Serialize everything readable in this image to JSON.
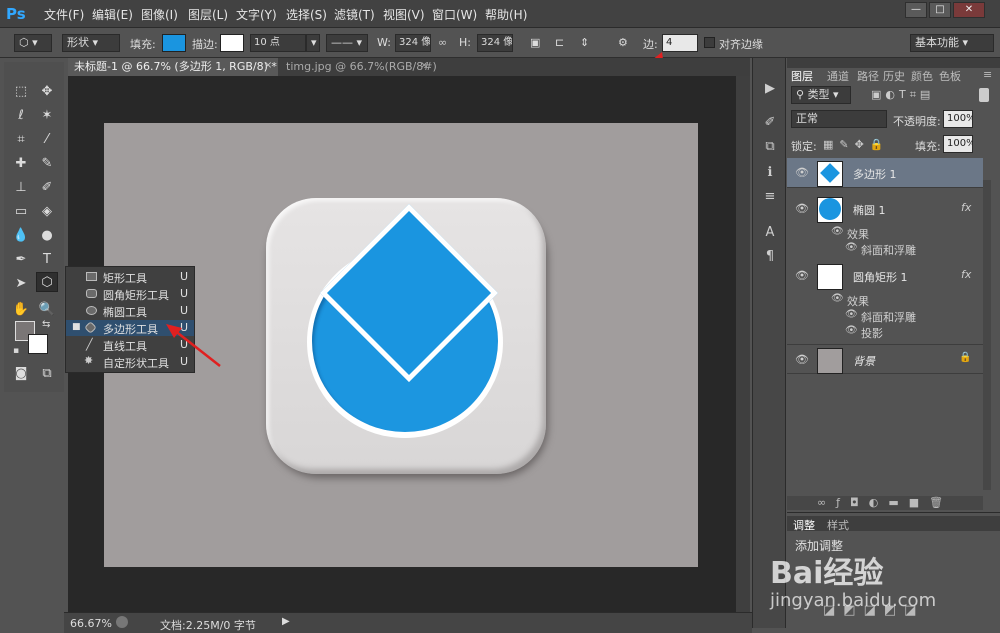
{
  "app": {
    "logo": "Ps"
  },
  "menu": [
    "文件(F)",
    "编辑(E)",
    "图像(I)",
    "图层(L)",
    "文字(Y)",
    "选择(S)",
    "滤镜(T)",
    "视图(V)",
    "窗口(W)",
    "帮助(H)"
  ],
  "window_controls": [
    "minimize-icon",
    "maximize-icon",
    "close-icon"
  ],
  "options_bar": {
    "mode": "形状",
    "fill_label": "填充:",
    "fill_color": "#1a95e0",
    "stroke_label": "描边:",
    "stroke_color": "#ffffff",
    "stroke_width": "10 点",
    "w_label": "W:",
    "w_value": "324 像",
    "h_label": "H:",
    "h_value": "324 像",
    "sides_label": "边:",
    "sides_value": "4",
    "align_edges": "对齐边缘",
    "workspace": "基本功能"
  },
  "doc_tabs": [
    {
      "title": "未标题-1 @ 66.7% (多边形 1, RGB/8) *",
      "active": true
    },
    {
      "title": "timg.jpg @ 66.7%(RGB/8#)",
      "active": false
    }
  ],
  "flyout": {
    "items": [
      {
        "label": "矩形工具",
        "key": "U",
        "selected": false
      },
      {
        "label": "圆角矩形工具",
        "key": "U",
        "selected": false
      },
      {
        "label": "椭圆工具",
        "key": "U",
        "selected": false
      },
      {
        "label": "多边形工具",
        "key": "U",
        "selected": true
      },
      {
        "label": "直线工具",
        "key": "U",
        "selected": false
      },
      {
        "label": "自定形状工具",
        "key": "U",
        "selected": false
      }
    ]
  },
  "layers_panel": {
    "tabs": [
      "图层",
      "通道",
      "路径",
      "历史",
      "颜色",
      "色板"
    ],
    "filter_kind": "类型",
    "blend_mode": "正常",
    "opacity_label": "不透明度:",
    "opacity_value": "100%",
    "lock_label": "锁定:",
    "fill_label": "填充:",
    "fill_value": "100%",
    "layers": [
      {
        "name": "多边形 1",
        "selected": true
      },
      {
        "name": "椭圆 1",
        "fx": "fx",
        "effects_label": "效果",
        "effects": [
          "斜面和浮雕"
        ]
      },
      {
        "name": "圆角矩形 1",
        "fx": "fx",
        "effects_label": "效果",
        "effects": [
          "斜面和浮雕",
          "投影"
        ]
      },
      {
        "name": "背景"
      }
    ]
  },
  "adjust_panel": {
    "tabs": [
      "调整",
      "样式"
    ],
    "title": "添加调整"
  },
  "status": {
    "zoom": "66.67%",
    "doc_info": "文档:2.25M/0 字节"
  },
  "watermark": {
    "brand": "Bai经验",
    "url": "jingyan.baidu.com"
  }
}
